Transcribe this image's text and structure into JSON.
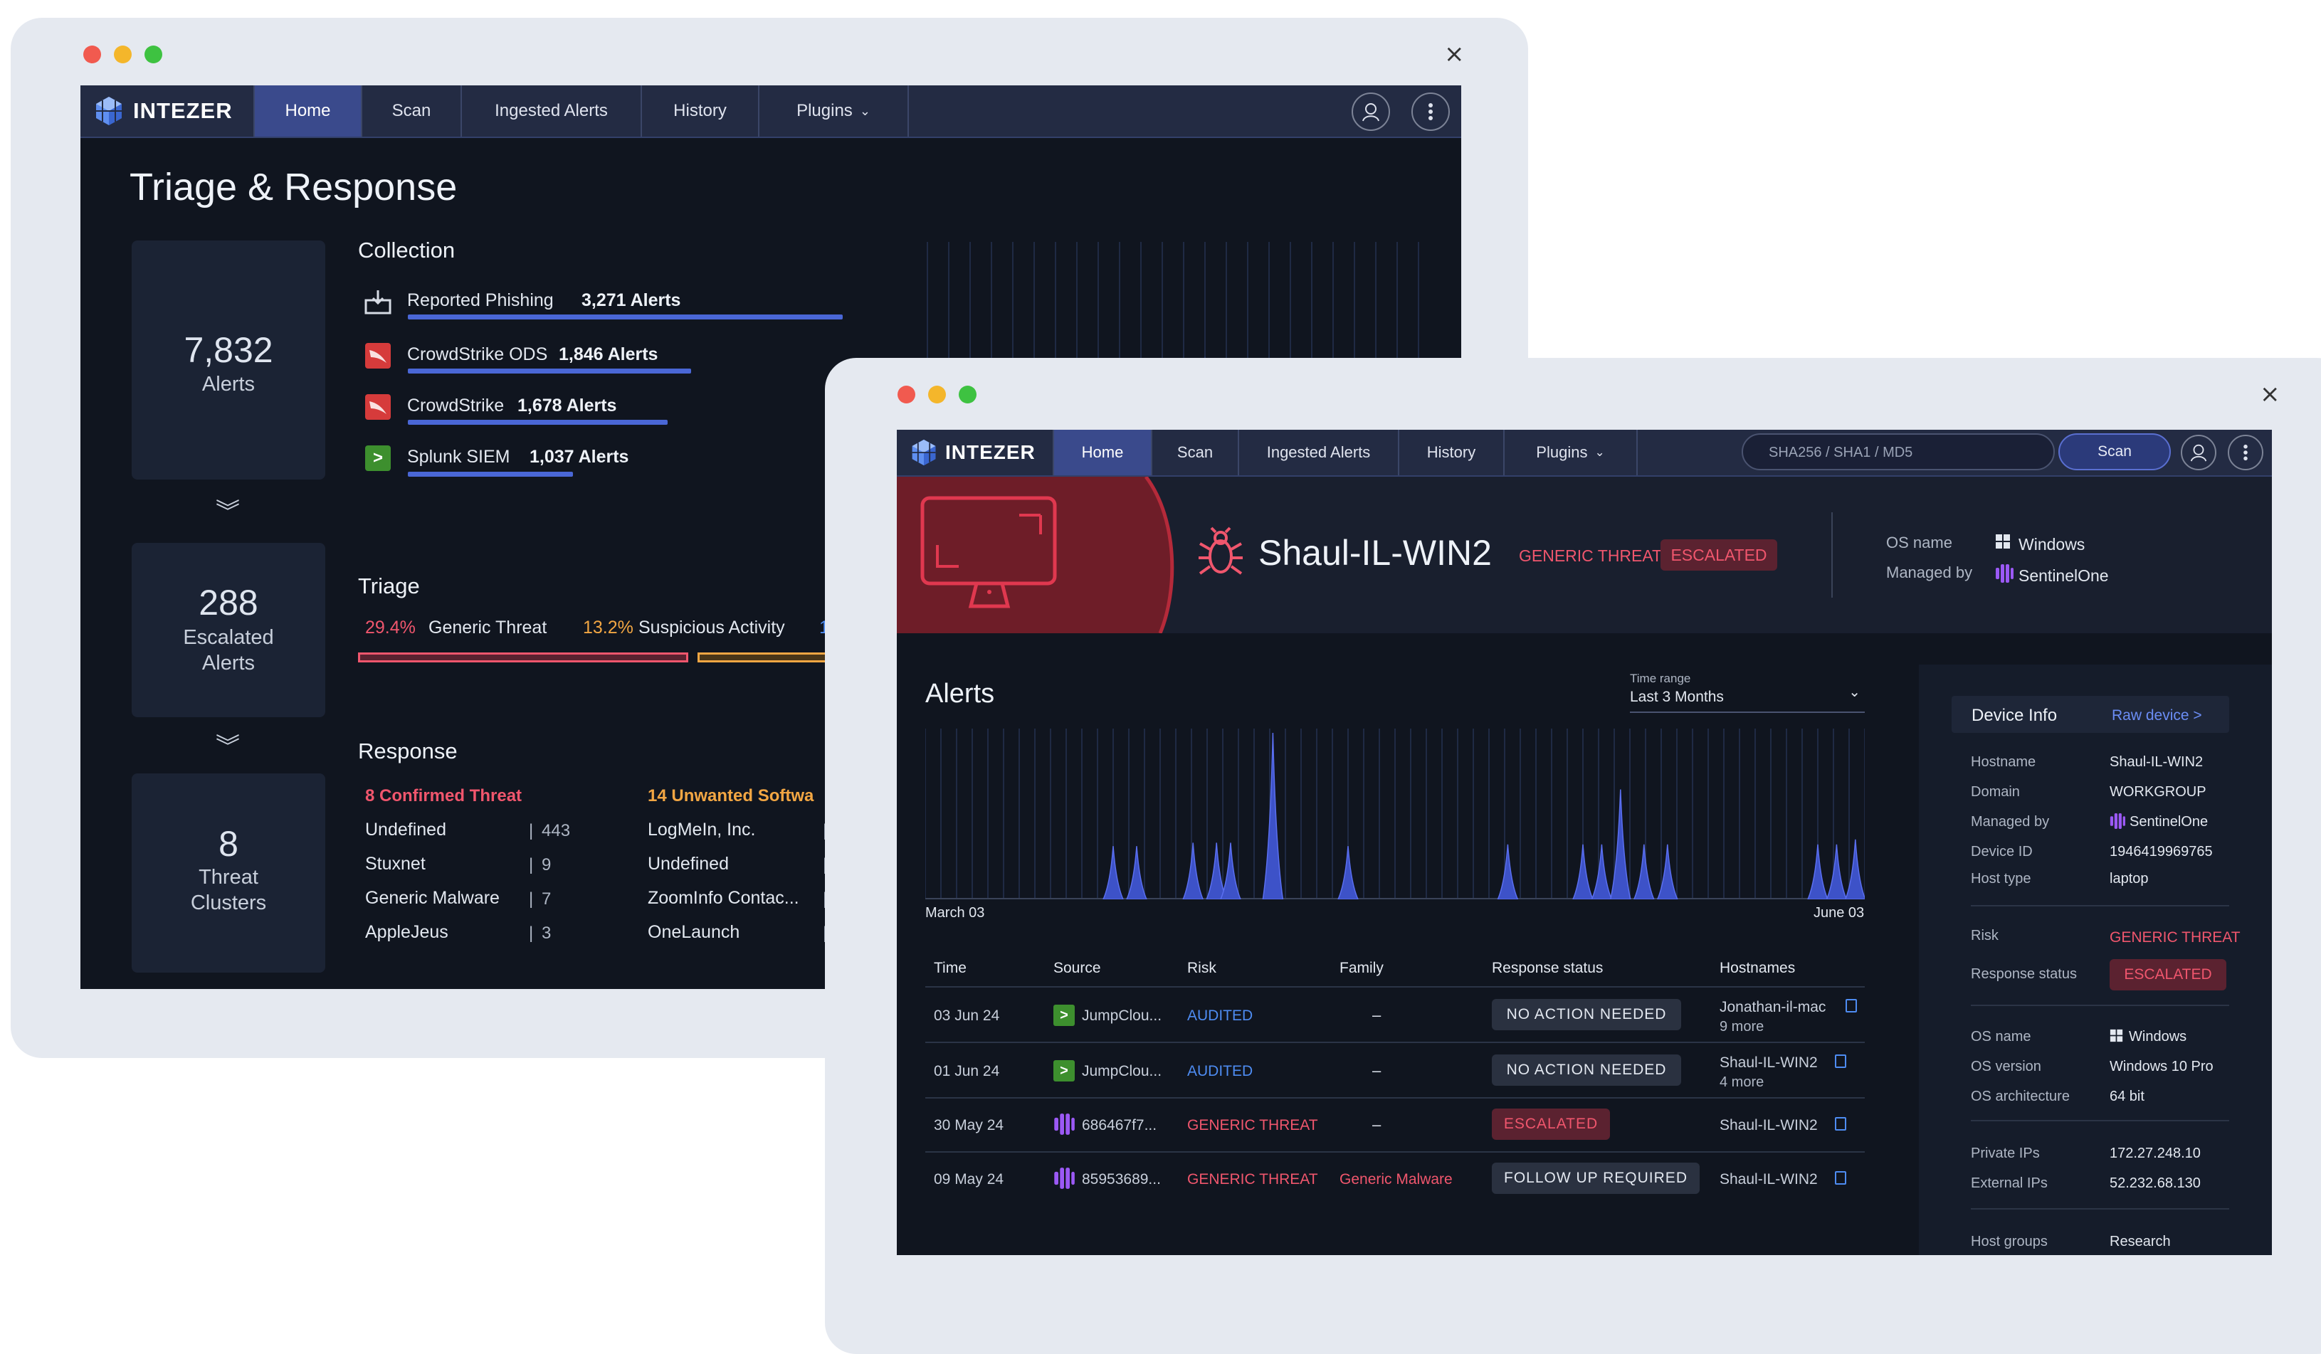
{
  "back_window": {
    "brand": "INTEZER",
    "tabs": [
      "Home",
      "Scan",
      "Ingested Alerts",
      "History",
      "Plugins"
    ],
    "close_glyph": "×",
    "page_title": "Triage & Response",
    "stats": [
      {
        "value": "7,832",
        "label_line1": "Alerts",
        "label_line2": ""
      },
      {
        "value": "288",
        "label_line1": "Escalated",
        "label_line2": "Alerts"
      },
      {
        "value": "8",
        "label_line1": "Threat",
        "label_line2": "Clusters"
      }
    ],
    "collection": {
      "title": "Collection",
      "items": [
        {
          "name": "Reported Phishing",
          "count": "3,271 Alerts",
          "icon": "phishing-inbox-icon",
          "fill": 0.92
        },
        {
          "name": "CrowdStrike ODS",
          "count": "1,846 Alerts",
          "icon": "crowdstrike-icon",
          "fill": 0.6
        },
        {
          "name": "CrowdStrike",
          "count": "1,678 Alerts",
          "icon": "crowdstrike-icon",
          "fill": 0.55
        },
        {
          "name": "Splunk SIEM",
          "count": "1,037 Alerts",
          "icon": "splunk-icon",
          "fill": 0.35
        }
      ]
    },
    "triage": {
      "title": "Triage",
      "items": [
        {
          "pct": "29.4%",
          "label": "Generic Threat",
          "color": "#f0566d"
        },
        {
          "pct": "13.2%",
          "label": "Suspicious Activity",
          "color": "#f2a643"
        },
        {
          "pct": "1.",
          "label": "",
          "color": "#4e8cf2"
        }
      ]
    },
    "response": {
      "title": "Response",
      "col1_header": "8 Confirmed Threat",
      "col1": [
        {
          "name": "Undefined",
          "count": "443"
        },
        {
          "name": "Stuxnet",
          "count": "9"
        },
        {
          "name": "Generic Malware",
          "count": "7"
        },
        {
          "name": "AppleJeus",
          "count": "3"
        }
      ],
      "col2_header": "14 Unwanted Softwa",
      "col2": [
        {
          "name": "LogMeIn, Inc."
        },
        {
          "name": "Undefined"
        },
        {
          "name": "ZoomInfo Contac..."
        },
        {
          "name": "OneLaunch"
        }
      ],
      "separator": "|"
    }
  },
  "front_window": {
    "brand": "INTEZER",
    "tabs": [
      "Home",
      "Scan",
      "Ingested Alerts",
      "History",
      "Plugins"
    ],
    "close_glyph": "×",
    "search_placeholder": "SHA256 / SHA1 / MD5",
    "scan_button": "Scan",
    "device": {
      "name": "Shaul-IL-WIN2",
      "risk": "GENERIC THREAT",
      "status": "ESCALATED",
      "os_label": "OS name",
      "os_value": "Windows",
      "managed_label": "Managed by",
      "managed_value": "SentinelOne"
    },
    "alerts": {
      "title": "Alerts",
      "time_range_label": "Time range",
      "time_range_value": "Last 3 Months",
      "x_start": "March 03",
      "x_end": "June 03"
    },
    "table": {
      "headers": [
        "Time",
        "Source",
        "Risk",
        "Family",
        "Response status",
        "Hostnames"
      ],
      "rows": [
        {
          "time": "03 Jun 24",
          "source_icon": "jumpcloud-icon",
          "source": "JumpClou...",
          "risk": "AUDITED",
          "risk_color": "#4e8cf2",
          "family": "–",
          "family_color": "#dfe5ef",
          "status": "NO ACTION NEEDED",
          "status_type": "neutral",
          "host": "Jonathan-il-mac",
          "more": "9 more"
        },
        {
          "time": "01 Jun 24",
          "source_icon": "jumpcloud-icon",
          "source": "JumpClou...",
          "risk": "AUDITED",
          "risk_color": "#4e8cf2",
          "family": "–",
          "family_color": "#dfe5ef",
          "status": "NO ACTION NEEDED",
          "status_type": "neutral",
          "host": "Shaul-IL-WIN2",
          "more": "4 more"
        },
        {
          "time": "30 May 24",
          "source_icon": "sentinelone-icon",
          "source": "686467f7...",
          "risk": "GENERIC THREAT",
          "risk_color": "#f0566d",
          "family": "–",
          "family_color": "#dfe5ef",
          "status": "ESCALATED",
          "status_type": "danger",
          "host": "Shaul-IL-WIN2",
          "more": ""
        },
        {
          "time": "09 May 24",
          "source_icon": "sentinelone-icon",
          "source": "85953689...",
          "risk": "GENERIC THREAT",
          "risk_color": "#f0566d",
          "family": "Generic Malware",
          "family_color": "#f0566d",
          "status": "FOLLOW UP REQUIRED",
          "status_type": "neutral",
          "host": "Shaul-IL-WIN2",
          "more": ""
        }
      ]
    },
    "device_info": {
      "title": "Device Info",
      "raw_link": "Raw device >",
      "group1": [
        {
          "label": "Hostname",
          "value": "Shaul-IL-WIN2"
        },
        {
          "label": "Domain",
          "value": "WORKGROUP"
        },
        {
          "label": "Managed by",
          "value": "SentinelOne"
        },
        {
          "label": "Device ID",
          "value": "1946419969765"
        },
        {
          "label": "Host type",
          "value": "laptop"
        }
      ],
      "risk_label": "Risk",
      "risk_value": "GENERIC THREAT",
      "response_label": "Response status",
      "response_value": "ESCALATED",
      "group3": [
        {
          "label": "OS name",
          "value": "Windows"
        },
        {
          "label": "OS version",
          "value": "Windows 10 Pro"
        },
        {
          "label": "OS architecture",
          "value": "64 bit"
        }
      ],
      "group4": [
        {
          "label": "Private IPs",
          "value": "172.27.248.10"
        },
        {
          "label": "External IPs",
          "value": "52.232.68.130"
        }
      ],
      "host_groups_label": "Host groups",
      "host_groups_value": "Research"
    }
  },
  "chart_data": {
    "type": "area",
    "x_start": "March 03",
    "x_end": "June 03",
    "peaks": [
      {
        "pos": 0.2,
        "height": 0.32
      },
      {
        "pos": 0.225,
        "height": 0.32
      },
      {
        "pos": 0.285,
        "height": 0.34
      },
      {
        "pos": 0.31,
        "height": 0.34
      },
      {
        "pos": 0.325,
        "height": 0.34
      },
      {
        "pos": 0.37,
        "height": 1.0
      },
      {
        "pos": 0.45,
        "height": 0.32
      },
      {
        "pos": 0.62,
        "height": 0.33
      },
      {
        "pos": 0.7,
        "height": 0.33
      },
      {
        "pos": 0.72,
        "height": 0.33
      },
      {
        "pos": 0.74,
        "height": 0.66
      },
      {
        "pos": 0.765,
        "height": 0.33
      },
      {
        "pos": 0.79,
        "height": 0.33
      },
      {
        "pos": 0.95,
        "height": 0.33
      },
      {
        "pos": 0.97,
        "height": 0.33
      },
      {
        "pos": 0.99,
        "height": 0.36
      }
    ]
  }
}
